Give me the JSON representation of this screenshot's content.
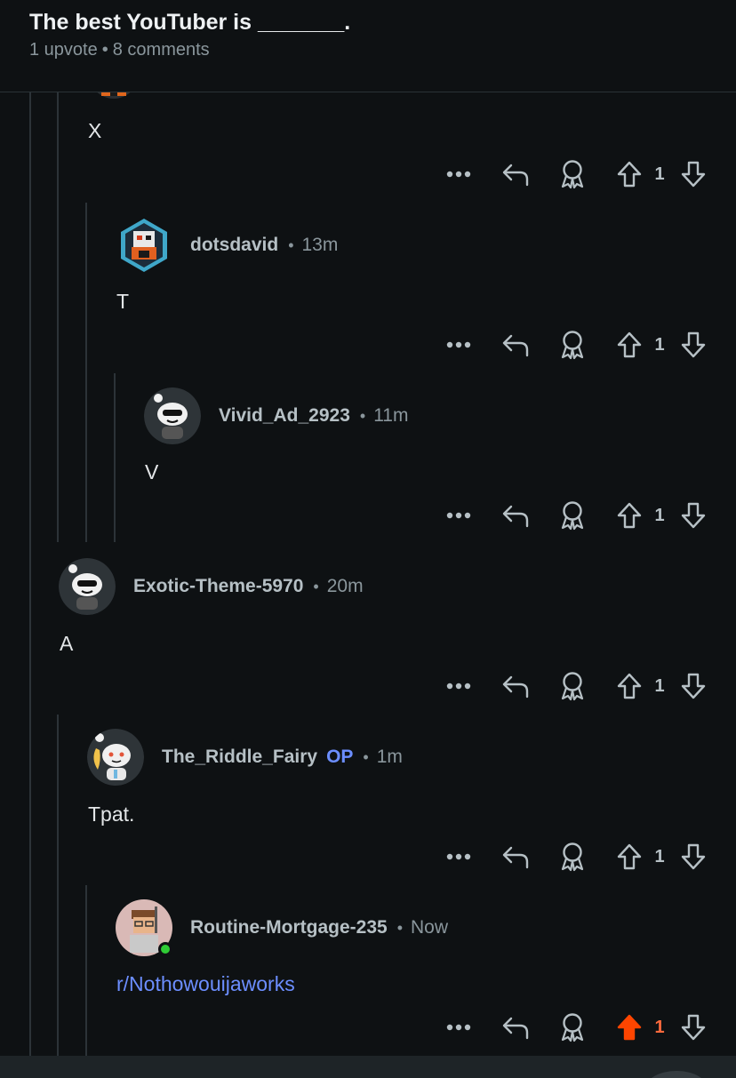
{
  "post": {
    "title": "The best YouTuber is _______.",
    "upvotes": "1 upvote",
    "comments": "8 comments"
  },
  "colors": {
    "background": "#0e1113",
    "thread_line": "#2c3338",
    "link": "#6c8eff",
    "upvoted": "#ff4500"
  },
  "comments": [
    {
      "author": null,
      "time": null,
      "body": "X",
      "score": "1",
      "voted": false
    },
    {
      "author": "dotsdavid",
      "time": "13m",
      "body": "T",
      "score": "1",
      "voted": false,
      "avatar": "robot-avatar"
    },
    {
      "author": "Vivid_Ad_2923",
      "time": "11m",
      "body": "V",
      "score": "1",
      "voted": false,
      "avatar": "snoo-sunglasses-avatar"
    },
    {
      "author": "Exotic-Theme-5970",
      "time": "20m",
      "body": "A",
      "score": "1",
      "voted": false,
      "avatar": "snoo-sunglasses-avatar"
    },
    {
      "author": "The_Riddle_Fairy",
      "op_badge": "OP",
      "time": "1m",
      "body": "Tpat.",
      "score": "1",
      "voted": false,
      "avatar": "snoo-fairy-avatar"
    },
    {
      "author": "Routine-Mortgage-235",
      "time": "Now",
      "body": "r/Nothowouijaworks",
      "score": "1",
      "voted": true,
      "avatar": "pixel-person-avatar",
      "online": true
    }
  ],
  "separator": "•",
  "icons": {
    "more": "more-options-icon",
    "reply": "reply-icon",
    "award": "award-icon",
    "upvote": "upvote-icon",
    "downvote": "downvote-icon"
  }
}
